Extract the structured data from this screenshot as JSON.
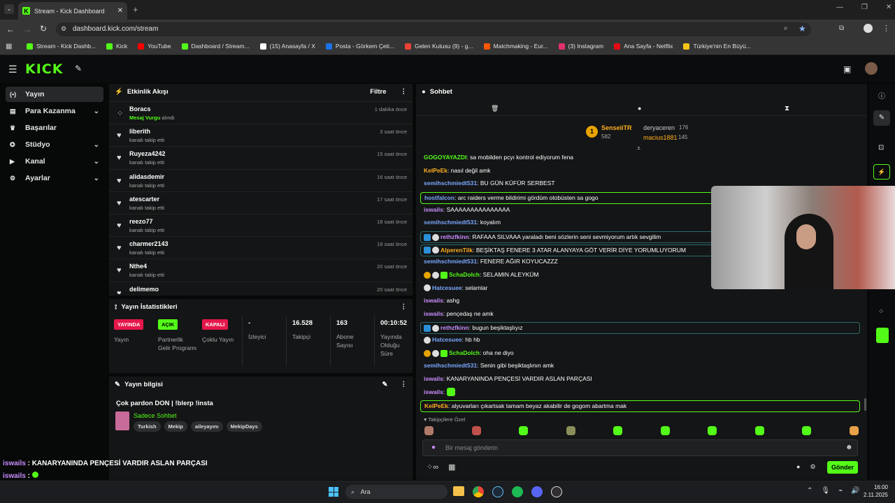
{
  "browser": {
    "tab_title": "Stream - Kick Dashboard",
    "url": "dashboard.kick.com/stream",
    "bookmarks": [
      {
        "label": "Stream - Kick Dashb...",
        "color": "#53fc18"
      },
      {
        "label": "Kick",
        "color": "#53fc18"
      },
      {
        "label": "YouTube",
        "color": "#ff0000"
      },
      {
        "label": "Dashboard / Stream...",
        "color": "#53fc18"
      },
      {
        "label": "(15) Anasayfa / X",
        "color": "#ffffff"
      },
      {
        "label": "Posta - Görkem Çeti...",
        "color": "#1a73e8"
      },
      {
        "label": "Gelen Kutusu (9) - g...",
        "color": "#ea4335"
      },
      {
        "label": "Matchmaking - Eur...",
        "color": "#ff5500"
      },
      {
        "label": "(3) Instagram",
        "color": "#e1306c"
      },
      {
        "label": "Ana Sayfa - Netflix",
        "color": "#e50914"
      },
      {
        "label": "Türkiye'nin En Büyü...",
        "color": "#f5c518"
      }
    ]
  },
  "sidebar": [
    {
      "label": "Yayın",
      "icon": "broadcast-icon",
      "chev": false,
      "active": true
    },
    {
      "label": "Para Kazanma",
      "icon": "money-icon",
      "chev": true
    },
    {
      "label": "Başarılar",
      "icon": "trophy-icon",
      "chev": false
    },
    {
      "label": "Stüdyo",
      "icon": "studio-icon",
      "chev": true
    },
    {
      "label": "Kanal",
      "icon": "channel-icon",
      "chev": true
    },
    {
      "label": "Ayarlar",
      "icon": "gear-icon",
      "chev": true
    }
  ],
  "activity": {
    "title": "Etkinlik Akışı",
    "filter": "Filtre",
    "items": [
      {
        "name": "Boracs",
        "sub_hl": "Mesaj Vurgu",
        "sub": " alındı",
        "time": "1 dakika önce"
      },
      {
        "name": "liberith",
        "sub": "kanalı takip etti",
        "time": "3 saat önce"
      },
      {
        "name": "Ruyeza4242",
        "sub": "kanalı takip etti",
        "time": "15 saat önce"
      },
      {
        "name": "alidasdemir",
        "sub": "kanalı takip etti",
        "time": "16 saat önce"
      },
      {
        "name": "atescarter",
        "sub": "kanalı takip etti",
        "time": "17 saat önce"
      },
      {
        "name": "reezo77",
        "sub": "kanalı takip etti",
        "time": "18 saat önce"
      },
      {
        "name": "charmer2143",
        "sub": "kanalı takip etti",
        "time": "19 saat önce"
      },
      {
        "name": "Nthe4",
        "sub": "kanalı takip etti",
        "time": "20 saat önce"
      },
      {
        "name": "delimemo",
        "sub": "",
        "time": "20 saat önce"
      }
    ]
  },
  "stats": {
    "title": "Yayın İstatistikleri",
    "cols": [
      {
        "badge": "YAYINDA",
        "badge_color": "#e5184b",
        "label": "Yayın"
      },
      {
        "badge": "AÇIK",
        "badge_color": "#53fc18",
        "label": "Partnerlik Gelir Programı"
      },
      {
        "badge": "KAPALI",
        "badge_color": "#e5184b",
        "label": "Çoklu Yayın"
      },
      {
        "value": "-",
        "label": "İzleyici"
      },
      {
        "value": "16.528",
        "label": "Takipçi"
      },
      {
        "value": "163",
        "label": "Abone Sayısı"
      },
      {
        "value": "00:10:52",
        "label": "Yayında Olduğu Süre"
      }
    ]
  },
  "info": {
    "title": "Yayın bilgisi",
    "stream_title": "Çok pardon DON | !blerp !insta",
    "category": "Sadece Sohbet",
    "tags": [
      "Turkish",
      "Mekip",
      "aileyayını",
      "MekipDays"
    ]
  },
  "chat": {
    "title": "Sohbet",
    "leaders": [
      {
        "rank": "1",
        "name": "SenseiiTR",
        "count": "582"
      },
      {
        "name": "deryaceren",
        "count": "176"
      },
      {
        "name": "macius1881",
        "count": "145"
      }
    ],
    "messages": [
      {
        "user": "GOGOYAYAZDI",
        "color": "#53fc18",
        "text": "sa mobilden pcyı kontrol ediyorum fena"
      },
      {
        "user": "KelPeEk",
        "color": "#ffb020",
        "text": "nasıl değil amk"
      },
      {
        "user": "semihschmiedt531",
        "color": "#7aa7ff",
        "text": "BU GÜN KÜFÜR SERBEST"
      },
      {
        "user": "hostfalcon",
        "color": "#7aa7ff",
        "text": "arc raiders verme bildirimi gördüm otobüsten sa gogo",
        "hl": true
      },
      {
        "user": "iswails",
        "color": "#c88dff",
        "text": "SAAAAAAAAAAAAAAA"
      },
      {
        "user": "semihschmiedt531",
        "color": "#7aa7ff",
        "text": "koyalım"
      },
      {
        "user": "rethzfkinn",
        "color": "#c88dff",
        "text": "RAFAAA SILVAAA yaraladı beni sözlerin seni sevmiyorum artık sevgilim",
        "hl2": true
      },
      {
        "user": "AlperenTilk",
        "color": "#ffb020",
        "text": "BEŞİKTAŞ FENERE 3 ATAR ALANYAYA GÖT VERİR DİYE YORUMLUYORUM",
        "hl2": true
      },
      {
        "user": "semihschmiedt531",
        "color": "#7aa7ff",
        "text": "FENERE AĞIR KOYUCAZZZ"
      },
      {
        "user": "SchaDolch",
        "color": "#53fc18",
        "text": "SELAMIN ALEYKÜM"
      },
      {
        "user": "Hatcesuee",
        "color": "#7aa7ff",
        "text": "selamlar"
      },
      {
        "user": "iswails",
        "color": "#c88dff",
        "text": "ashg"
      },
      {
        "user": "iswails",
        "color": "#c88dff",
        "text": "pençedaş ne amk"
      },
      {
        "user": "rethzfkinn",
        "color": "#c88dff",
        "text": "bugun beşiktaşlıyız",
        "hl2": true
      },
      {
        "user": "Hatcesuee",
        "color": "#7aa7ff",
        "text": "hb hb"
      },
      {
        "user": "SchaDolch",
        "color": "#53fc18",
        "text": "oha ne diyo"
      },
      {
        "user": "semihschmiedt531",
        "color": "#7aa7ff",
        "text": "Senin gibi beşiktaşlının amk"
      },
      {
        "user": "iswails",
        "color": "#c88dff",
        "text": "KANARYANINDA PENÇESİ VARDIR ASLAN PARÇASI"
      },
      {
        "user": "iswails",
        "color": "#c88dff",
        "text": ""
      },
      {
        "user": "KelPeEk",
        "color": "#ffb020",
        "text": "alyuvarları çıkartsak tamam beyaz akabilir de gogom abartma mak",
        "hl": true
      }
    ],
    "followers_label": "Takipçilere Özel",
    "input_placeholder": "Bir mesaj gönderin",
    "send_label": "Gönder"
  },
  "overlay": {
    "line1_user": "iswails",
    "line1_text": "KANARYANINDA PENÇESİ VARDIR ASLAN PARÇASI",
    "line2_user": "iswails"
  },
  "taskbar": {
    "search": "Ara",
    "time": "16:00",
    "date": "2.11.2025"
  }
}
